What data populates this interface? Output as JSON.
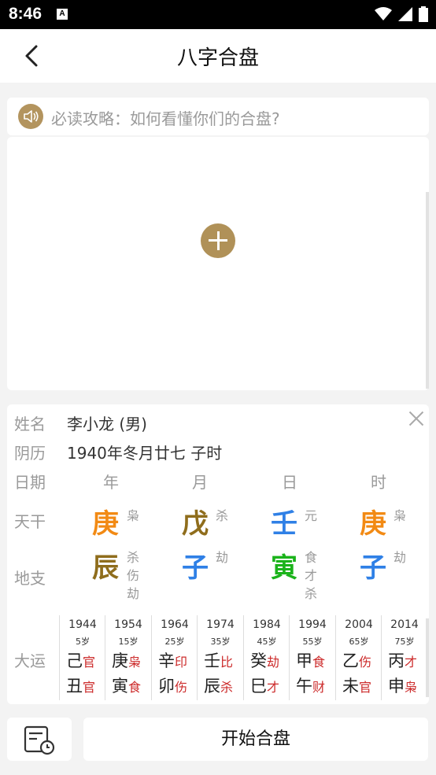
{
  "status": {
    "time": "8:46",
    "a_icon": "A"
  },
  "header": {
    "title": "八字合盘"
  },
  "tip": {
    "text": "必读攻略：如何看懂你们的合盘?"
  },
  "person": {
    "name_label": "姓名",
    "name_value": "李小龙 (男)",
    "lunar_label": "阴历",
    "lunar_value": "1940年冬月廿七 子时"
  },
  "table": {
    "date_label": "日期",
    "columns": [
      "年",
      "月",
      "日",
      "时"
    ],
    "tiangan_label": "天干",
    "tiangan": [
      {
        "char": "庚",
        "color": "#f28a14",
        "god": [
          "枭"
        ]
      },
      {
        "char": "戊",
        "color": "#8f6d1c",
        "god": [
          "杀"
        ]
      },
      {
        "char": "壬",
        "color": "#2f80e6",
        "god": [
          "元"
        ]
      },
      {
        "char": "庚",
        "color": "#f28a14",
        "god": [
          "枭"
        ]
      }
    ],
    "dizhi_label": "地支",
    "dizhi": [
      {
        "char": "辰",
        "color": "#8f6d1c",
        "god": [
          "杀",
          "伤",
          "劫"
        ]
      },
      {
        "char": "子",
        "color": "#2f80e6",
        "god": [
          "劫"
        ]
      },
      {
        "char": "寅",
        "color": "#1bb31b",
        "god": [
          "食",
          "才",
          "杀"
        ]
      },
      {
        "char": "子",
        "color": "#2f80e6",
        "god": [
          "劫"
        ]
      }
    ]
  },
  "dayun": {
    "label": "大运",
    "items": [
      {
        "year": "1944",
        "age": "5岁",
        "gan": "己",
        "gan_god": "官",
        "zhi": "丑",
        "zhi_god": "官"
      },
      {
        "year": "1954",
        "age": "15岁",
        "gan": "庚",
        "gan_god": "枭",
        "zhi": "寅",
        "zhi_god": "食"
      },
      {
        "year": "1964",
        "age": "25岁",
        "gan": "辛",
        "gan_god": "印",
        "zhi": "卯",
        "zhi_god": "伤"
      },
      {
        "year": "1974",
        "age": "35岁",
        "gan": "壬",
        "gan_god": "比",
        "zhi": "辰",
        "zhi_god": "杀"
      },
      {
        "year": "1984",
        "age": "45岁",
        "gan": "癸",
        "gan_god": "劫",
        "zhi": "巳",
        "zhi_god": "才"
      },
      {
        "year": "1994",
        "age": "55岁",
        "gan": "甲",
        "gan_god": "食",
        "zhi": "午",
        "zhi_god": "财"
      },
      {
        "year": "2004",
        "age": "65岁",
        "gan": "乙",
        "gan_god": "伤",
        "zhi": "未",
        "zhi_god": "官"
      },
      {
        "year": "2014",
        "age": "75岁",
        "gan": "丙",
        "gan_god": "才",
        "zhi": "申",
        "zhi_god": "枭"
      }
    ]
  },
  "footer": {
    "start_label": "开始合盘"
  },
  "colors": {
    "accent": "#b09158",
    "god_red": "#cc2a2a"
  }
}
